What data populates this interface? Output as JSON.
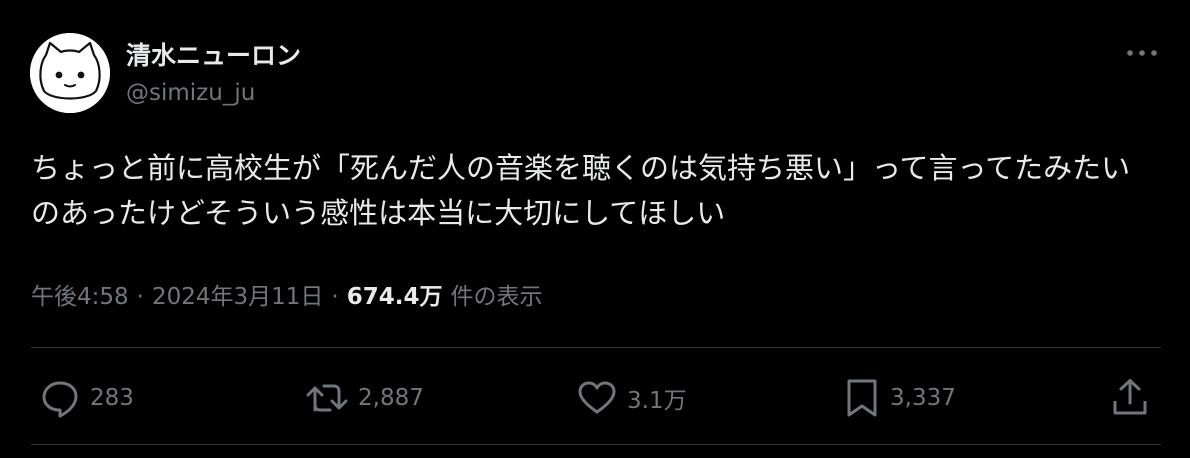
{
  "author": {
    "display_name": "清水ニューロン",
    "handle": "@simizu_ju",
    "avatar_icon": "cat-face-icon"
  },
  "tweet": {
    "text": "ちょっと前に高校生が「死んだ人の音楽を聴くのは気持ち悪い」って言ってたみたいのあったけどそういう感性は本当に大切にしてほしい",
    "time": "午後4:58",
    "separator": "·",
    "date": "2024年3月11日",
    "views_count": "674.4万",
    "views_label": "件の表示"
  },
  "actions": {
    "reply": {
      "count": "283",
      "icon": "reply-bubble-icon"
    },
    "retweet": {
      "count": "2,887",
      "icon": "retweet-icon"
    },
    "like": {
      "count": "3.1万",
      "icon": "heart-icon"
    },
    "bookmark": {
      "count": "3,337",
      "icon": "bookmark-icon"
    },
    "share": {
      "icon": "share-icon"
    }
  },
  "more_icon": "more-dots-icon",
  "colors": {
    "background": "#000000",
    "primary_text": "#e7e9ea",
    "secondary_text": "#71767b",
    "divider": "#2f3336"
  }
}
